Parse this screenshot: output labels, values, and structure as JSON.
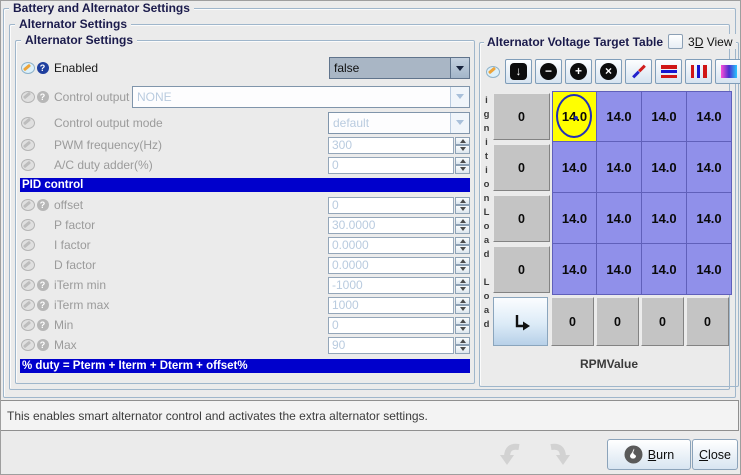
{
  "window": {
    "title": "Battery and Alternator Settings"
  },
  "groups": {
    "outer_title": "Battery and Alternator Settings",
    "mid_title": "Alternator Settings",
    "left_title": "Alternator Settings"
  },
  "form": {
    "rows": [
      {
        "label": "Enabled",
        "value": "false",
        "control": "combo",
        "enabled": true,
        "has_help": true
      },
      {
        "label": "Control output",
        "value": "NONE",
        "control": "combo",
        "enabled": false,
        "has_help": true
      },
      {
        "label": "Control output mode",
        "value": "default",
        "control": "combo",
        "enabled": false,
        "has_help": false
      },
      {
        "label": "PWM frequency(Hz)",
        "value": "300",
        "control": "spinner",
        "enabled": false,
        "has_help": false
      },
      {
        "label": "A/C duty adder(%)",
        "value": "0",
        "control": "spinner",
        "enabled": false,
        "has_help": false
      },
      {
        "label": "offset",
        "value": "0",
        "control": "spinner",
        "enabled": false,
        "has_help": true
      },
      {
        "label": "P factor",
        "value": "30.0000",
        "control": "spinner",
        "enabled": false,
        "has_help": false
      },
      {
        "label": "I factor",
        "value": "0.0000",
        "control": "spinner",
        "enabled": false,
        "has_help": false
      },
      {
        "label": "D factor",
        "value": "0.0000",
        "control": "spinner",
        "enabled": false,
        "has_help": false
      },
      {
        "label": "iTerm min",
        "value": "-1000",
        "control": "spinner",
        "enabled": false,
        "has_help": true
      },
      {
        "label": "iTerm max",
        "value": "1000",
        "control": "spinner",
        "enabled": false,
        "has_help": true
      },
      {
        "label": "Min",
        "value": "0",
        "control": "spinner",
        "enabled": false,
        "has_help": true
      },
      {
        "label": "Max",
        "value": "90",
        "control": "spinner",
        "enabled": false,
        "has_help": true
      }
    ],
    "pid_header": "PID control",
    "formula": "% duty = Pterm + Iterm + Dterm + offset%"
  },
  "table_panel": {
    "title": "Alternator Voltage Target Table",
    "view3d": {
      "pre": "3",
      "key": "D",
      "post": " View",
      "checked": false
    },
    "toolbar_icons": [
      "down-arrow",
      "minus",
      "plus",
      "x",
      "pencil",
      "h-stripes",
      "v-stripes",
      "gradient"
    ],
    "y_axis_label": "ignitionLoad Load",
    "x_axis_label": "RPMValue",
    "y_bins": [
      "0",
      "0",
      "0",
      "0"
    ],
    "x_bins": [
      "0",
      "0",
      "0",
      "0"
    ],
    "cells": [
      [
        "14.0",
        "14.0",
        "14.0",
        "14.0"
      ],
      [
        "14.0",
        "14.0",
        "14.0",
        "14.0"
      ],
      [
        "14.0",
        "14.0",
        "14.0",
        "14.0"
      ],
      [
        "14.0",
        "14.0",
        "14.0",
        "14.0"
      ]
    ],
    "selected_cell": {
      "row": 0,
      "col": 0
    }
  },
  "status_bar": {
    "text": "This enables smart alternator control and activates the extra alternator settings."
  },
  "footer": {
    "burn": {
      "key": "B",
      "post": "urn"
    },
    "close": {
      "key": "C",
      "post": "lose"
    }
  },
  "colors": {
    "pid_bar": "#0000cc",
    "cell_purple": "#9090ea",
    "cell_selected": "#ffff00",
    "cell_gray": "#c4c4c4",
    "group_title": "#1b1b4c"
  }
}
